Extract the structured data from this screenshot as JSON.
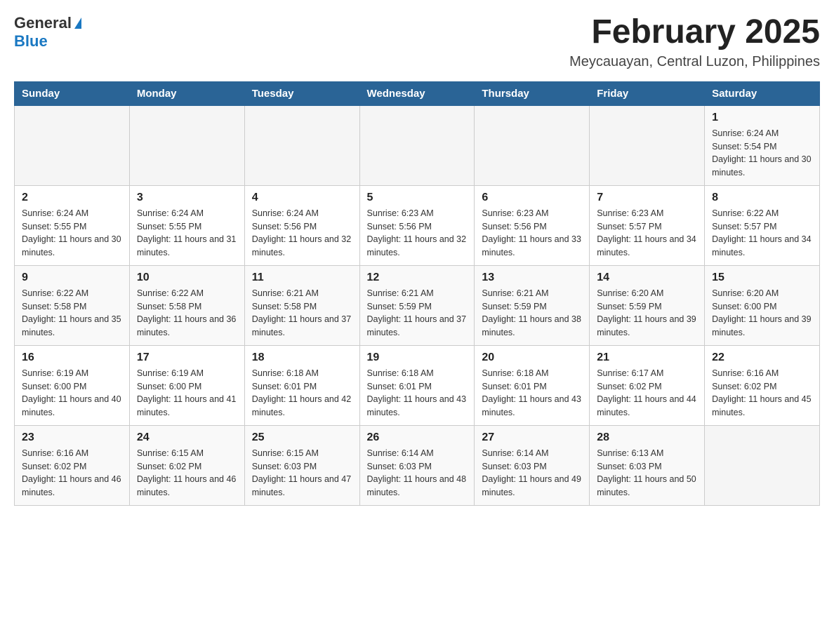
{
  "header": {
    "logo_general": "General",
    "logo_blue": "Blue",
    "month_year": "February 2025",
    "location": "Meycauayan, Central Luzon, Philippines"
  },
  "days_of_week": [
    "Sunday",
    "Monday",
    "Tuesday",
    "Wednesday",
    "Thursday",
    "Friday",
    "Saturday"
  ],
  "weeks": [
    [
      {
        "day": "",
        "sunrise": "",
        "sunset": "",
        "daylight": ""
      },
      {
        "day": "",
        "sunrise": "",
        "sunset": "",
        "daylight": ""
      },
      {
        "day": "",
        "sunrise": "",
        "sunset": "",
        "daylight": ""
      },
      {
        "day": "",
        "sunrise": "",
        "sunset": "",
        "daylight": ""
      },
      {
        "day": "",
        "sunrise": "",
        "sunset": "",
        "daylight": ""
      },
      {
        "day": "",
        "sunrise": "",
        "sunset": "",
        "daylight": ""
      },
      {
        "day": "1",
        "sunrise": "Sunrise: 6:24 AM",
        "sunset": "Sunset: 5:54 PM",
        "daylight": "Daylight: 11 hours and 30 minutes."
      }
    ],
    [
      {
        "day": "2",
        "sunrise": "Sunrise: 6:24 AM",
        "sunset": "Sunset: 5:55 PM",
        "daylight": "Daylight: 11 hours and 30 minutes."
      },
      {
        "day": "3",
        "sunrise": "Sunrise: 6:24 AM",
        "sunset": "Sunset: 5:55 PM",
        "daylight": "Daylight: 11 hours and 31 minutes."
      },
      {
        "day": "4",
        "sunrise": "Sunrise: 6:24 AM",
        "sunset": "Sunset: 5:56 PM",
        "daylight": "Daylight: 11 hours and 32 minutes."
      },
      {
        "day": "5",
        "sunrise": "Sunrise: 6:23 AM",
        "sunset": "Sunset: 5:56 PM",
        "daylight": "Daylight: 11 hours and 32 minutes."
      },
      {
        "day": "6",
        "sunrise": "Sunrise: 6:23 AM",
        "sunset": "Sunset: 5:56 PM",
        "daylight": "Daylight: 11 hours and 33 minutes."
      },
      {
        "day": "7",
        "sunrise": "Sunrise: 6:23 AM",
        "sunset": "Sunset: 5:57 PM",
        "daylight": "Daylight: 11 hours and 34 minutes."
      },
      {
        "day": "8",
        "sunrise": "Sunrise: 6:22 AM",
        "sunset": "Sunset: 5:57 PM",
        "daylight": "Daylight: 11 hours and 34 minutes."
      }
    ],
    [
      {
        "day": "9",
        "sunrise": "Sunrise: 6:22 AM",
        "sunset": "Sunset: 5:58 PM",
        "daylight": "Daylight: 11 hours and 35 minutes."
      },
      {
        "day": "10",
        "sunrise": "Sunrise: 6:22 AM",
        "sunset": "Sunset: 5:58 PM",
        "daylight": "Daylight: 11 hours and 36 minutes."
      },
      {
        "day": "11",
        "sunrise": "Sunrise: 6:21 AM",
        "sunset": "Sunset: 5:58 PM",
        "daylight": "Daylight: 11 hours and 37 minutes."
      },
      {
        "day": "12",
        "sunrise": "Sunrise: 6:21 AM",
        "sunset": "Sunset: 5:59 PM",
        "daylight": "Daylight: 11 hours and 37 minutes."
      },
      {
        "day": "13",
        "sunrise": "Sunrise: 6:21 AM",
        "sunset": "Sunset: 5:59 PM",
        "daylight": "Daylight: 11 hours and 38 minutes."
      },
      {
        "day": "14",
        "sunrise": "Sunrise: 6:20 AM",
        "sunset": "Sunset: 5:59 PM",
        "daylight": "Daylight: 11 hours and 39 minutes."
      },
      {
        "day": "15",
        "sunrise": "Sunrise: 6:20 AM",
        "sunset": "Sunset: 6:00 PM",
        "daylight": "Daylight: 11 hours and 39 minutes."
      }
    ],
    [
      {
        "day": "16",
        "sunrise": "Sunrise: 6:19 AM",
        "sunset": "Sunset: 6:00 PM",
        "daylight": "Daylight: 11 hours and 40 minutes."
      },
      {
        "day": "17",
        "sunrise": "Sunrise: 6:19 AM",
        "sunset": "Sunset: 6:00 PM",
        "daylight": "Daylight: 11 hours and 41 minutes."
      },
      {
        "day": "18",
        "sunrise": "Sunrise: 6:18 AM",
        "sunset": "Sunset: 6:01 PM",
        "daylight": "Daylight: 11 hours and 42 minutes."
      },
      {
        "day": "19",
        "sunrise": "Sunrise: 6:18 AM",
        "sunset": "Sunset: 6:01 PM",
        "daylight": "Daylight: 11 hours and 43 minutes."
      },
      {
        "day": "20",
        "sunrise": "Sunrise: 6:18 AM",
        "sunset": "Sunset: 6:01 PM",
        "daylight": "Daylight: 11 hours and 43 minutes."
      },
      {
        "day": "21",
        "sunrise": "Sunrise: 6:17 AM",
        "sunset": "Sunset: 6:02 PM",
        "daylight": "Daylight: 11 hours and 44 minutes."
      },
      {
        "day": "22",
        "sunrise": "Sunrise: 6:16 AM",
        "sunset": "Sunset: 6:02 PM",
        "daylight": "Daylight: 11 hours and 45 minutes."
      }
    ],
    [
      {
        "day": "23",
        "sunrise": "Sunrise: 6:16 AM",
        "sunset": "Sunset: 6:02 PM",
        "daylight": "Daylight: 11 hours and 46 minutes."
      },
      {
        "day": "24",
        "sunrise": "Sunrise: 6:15 AM",
        "sunset": "Sunset: 6:02 PM",
        "daylight": "Daylight: 11 hours and 46 minutes."
      },
      {
        "day": "25",
        "sunrise": "Sunrise: 6:15 AM",
        "sunset": "Sunset: 6:03 PM",
        "daylight": "Daylight: 11 hours and 47 minutes."
      },
      {
        "day": "26",
        "sunrise": "Sunrise: 6:14 AM",
        "sunset": "Sunset: 6:03 PM",
        "daylight": "Daylight: 11 hours and 48 minutes."
      },
      {
        "day": "27",
        "sunrise": "Sunrise: 6:14 AM",
        "sunset": "Sunset: 6:03 PM",
        "daylight": "Daylight: 11 hours and 49 minutes."
      },
      {
        "day": "28",
        "sunrise": "Sunrise: 6:13 AM",
        "sunset": "Sunset: 6:03 PM",
        "daylight": "Daylight: 11 hours and 50 minutes."
      },
      {
        "day": "",
        "sunrise": "",
        "sunset": "",
        "daylight": ""
      }
    ]
  ]
}
